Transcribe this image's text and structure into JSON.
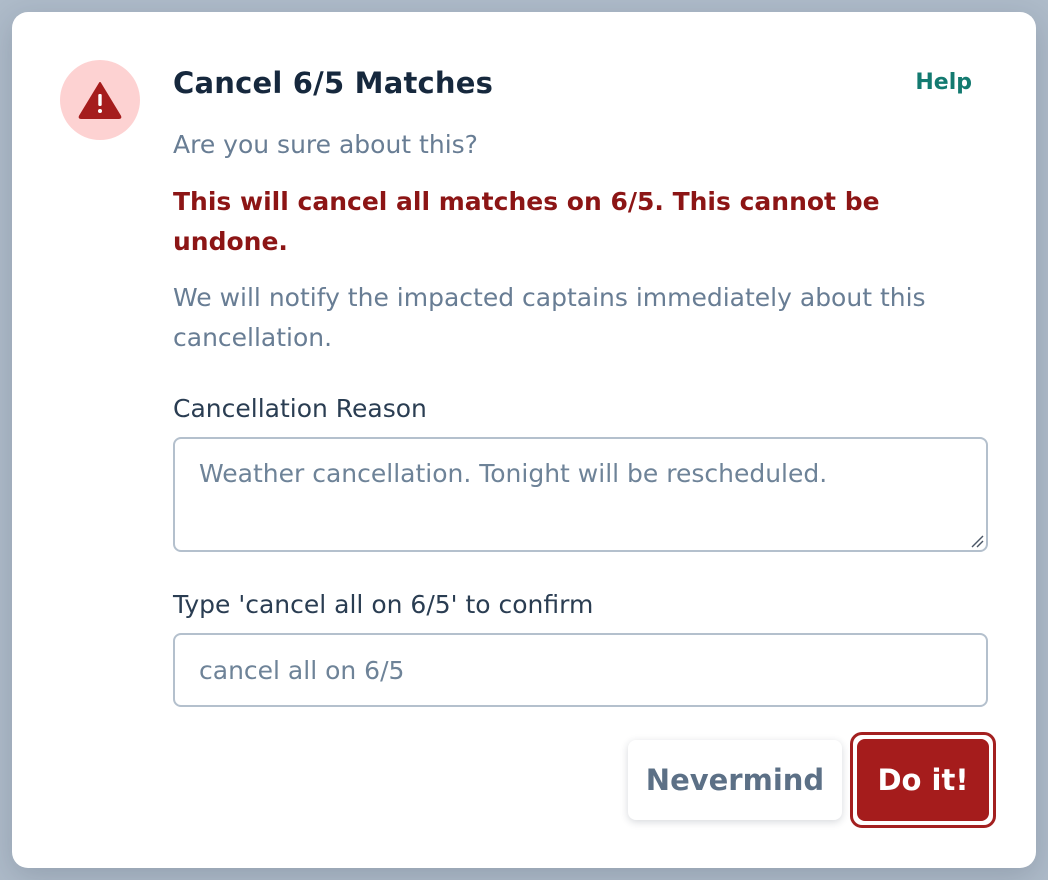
{
  "dialog": {
    "title": "Cancel 6/5 Matches",
    "help_label": "Help",
    "subtitle": "Are you sure about this?",
    "danger_text": "This will cancel all matches on 6/5. This cannot be undone.",
    "notice_text": "We will notify the impacted captains immediately about this cancellation.",
    "warning_icon": "warning-triangle-icon",
    "colors": {
      "accent_danger": "#a51c1c",
      "danger_text": "#8c1515",
      "help_link": "#137a70",
      "icon_circle": "#fdd2d2"
    }
  },
  "form": {
    "reason_label": "Cancellation Reason",
    "reason_value": "Weather cancellation. Tonight will be rescheduled.",
    "confirm_label": "Type 'cancel all on 6/5' to confirm",
    "confirm_value": "cancel all on 6/5"
  },
  "actions": {
    "nevermind_label": "Nevermind",
    "confirm_label": "Do it!"
  }
}
